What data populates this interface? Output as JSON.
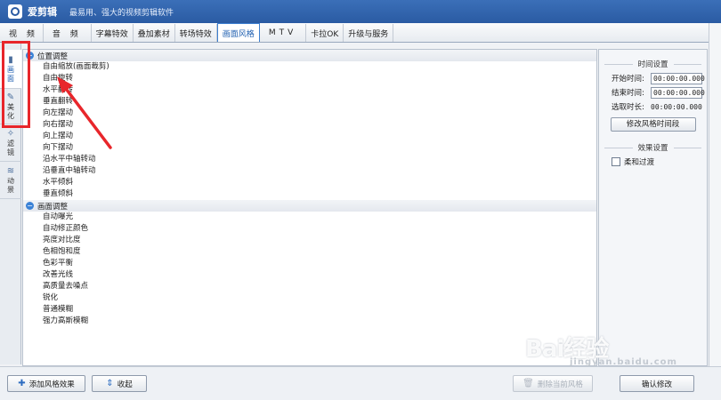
{
  "app": {
    "name": "爱剪辑",
    "slogan": "最易用、强大的视频剪辑软件"
  },
  "tabs": [
    {
      "label": "视 频",
      "active": false
    },
    {
      "label": "音 频",
      "active": false
    },
    {
      "label": "字幕特效",
      "active": false
    },
    {
      "label": "叠加素材",
      "active": false
    },
    {
      "label": "转场特效",
      "active": false
    },
    {
      "label": "画面风格",
      "active": true
    },
    {
      "label": "MTV",
      "active": false
    },
    {
      "label": "卡拉OK",
      "active": false
    },
    {
      "label": "升级与服务",
      "active": false
    }
  ],
  "side_tabs": [
    {
      "label": "画面",
      "icon": "film-icon",
      "active": true
    },
    {
      "label": "美化",
      "icon": "brush-icon",
      "active": false
    },
    {
      "label": "滤镜",
      "icon": "wand-icon",
      "active": false
    },
    {
      "label": "动景",
      "icon": "wave-icon",
      "active": false
    }
  ],
  "groups": [
    {
      "title": "位置调整",
      "icon": "expand-icon",
      "items": [
        "自由缩放(画面裁剪)",
        "自由旋转",
        "水平翻转",
        "垂直翻转",
        "向左摆动",
        "向右摆动",
        "向上摆动",
        "向下摆动",
        "沿水平中轴转动",
        "沿垂直中轴转动",
        "水平倾斜",
        "垂直倾斜"
      ]
    },
    {
      "title": "画面调整",
      "icon": "collapse-icon",
      "items": [
        "自动曝光",
        "自动修正颜色",
        "亮度对比度",
        "色相饱和度",
        "色彩平衡",
        "改善光线",
        "高质量去噪点",
        "锐化",
        "普通模糊",
        "强力高斯模糊"
      ]
    }
  ],
  "time_panel": {
    "title": "时间设置",
    "start_label": "开始时间:",
    "start_value": "00:00:00.000",
    "end_label": "结束时间:",
    "end_value": "00:00:00.000",
    "duration_label": "选取时长:",
    "duration_value": "00:00:00.000",
    "modify_button": "修改风格时间段"
  },
  "effect_panel": {
    "title": "效果设置",
    "smooth_label": "柔和过渡",
    "smooth_checked": false
  },
  "bottom": {
    "add_button": "添加风格效果",
    "collapse_button": "收起",
    "delete_button": "删除当前风格",
    "confirm_button": "确认修改"
  },
  "colors": {
    "accent": "#3b82d6",
    "annotation": "#e8262b",
    "titlebar": "#2a5ba3"
  },
  "watermark": {
    "brand": "Bai经验",
    "domain": "jingyan.baidu.com"
  }
}
